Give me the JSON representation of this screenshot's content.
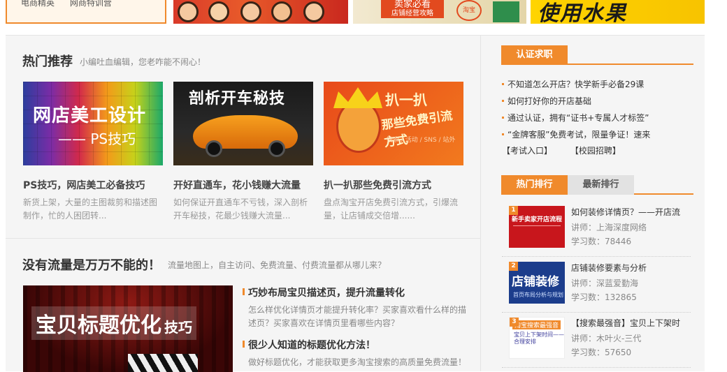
{
  "top": {
    "card1_items": [
      "电商精英",
      "网商特训营"
    ],
    "banner3_tag": "卖家必看",
    "banner3_sub": "店铺经营攻略",
    "banner3_seal": "淘宝",
    "banner4_text": "使用水果"
  },
  "hot": {
    "title": "热门推荐",
    "subtitle": "小编吐血编辑，您老咋能不闹心！",
    "cards": [
      {
        "thumb_line1": "网店美工设计",
        "thumb_line2": "—— PS技巧",
        "title": "PS技巧，网店美工必备技巧",
        "desc": "新货上架，大量的主图裁剪和描述图制作，忙的人困团转..."
      },
      {
        "thumb_line1": "剖析开车秘技",
        "title": "开好直通车，花小钱赚大流量",
        "desc": "如何保证开直通车不亏钱，深入剖析开车秘技，花最少钱赚大流量..."
      },
      {
        "thumb_line1": "扒一扒",
        "thumb_line2": "那些免费引流方式",
        "thumb_line3": "搜索 / 活动 / SNS / 站外",
        "title": "扒一扒那些免费引流方式",
        "desc": "盘点淘宝开店免费引流方式，引爆流量，让店铺成交倍增......"
      }
    ]
  },
  "traffic": {
    "title": "没有流量是万万不能的！",
    "subtitle": "流量地图上，自主访问、免费流量、付费流量都从哪儿来？",
    "thumb_text": "宝贝标题优化",
    "thumb_small": "技巧",
    "articles": [
      {
        "title": "巧妙布局宝贝描述页，提升流量转化",
        "desc": "怎么样优化详情页才能提升转化率？买家喜欢看什么样的描述页？买家喜欢在详情页里看哪些内容？"
      },
      {
        "title": "很少人知道的标题优化方法！",
        "desc": "做好标题优化，才能获取更多淘宝搜索的高质量免费流量！"
      }
    ]
  },
  "cert": {
    "tab": "认证求职",
    "items": [
      "不知道怎么开店？快学新手必备29课",
      "如何打好你的开店基础",
      "通过认证，拥有“证书+专属人才标签”",
      "“金牌客服”免费考试，限量争证！速来"
    ],
    "links": [
      "【考试入口】",
      "【校园招聘】"
    ]
  },
  "rank": {
    "tab_hot": "热门排行",
    "tab_new": "最新排行",
    "lecturer_label": "讲师：",
    "count_label": "学习数：",
    "items": [
      {
        "badge": "1",
        "pic_text": "新手卖家开店流程",
        "title": "如何装修详情页？——开店流",
        "lecturer": "上海深度网络",
        "count": "78446"
      },
      {
        "badge": "2",
        "pic_text": "店铺装修",
        "pic_sub": "首页布局分析与规划",
        "title": "店铺装修要素与分析",
        "lecturer": "深蓝爱勤海",
        "count": "132865"
      },
      {
        "badge": "3",
        "pic_text": "淘宝搜索最强音",
        "pic_sub": "宝贝上下架时间——合理安排",
        "title": "【搜索最强音】宝贝上下架时",
        "lecturer": "木叶火-三代",
        "count": "57650"
      }
    ]
  },
  "colors": {
    "accent": "#f08a2c",
    "panel": "#f5f5f5"
  }
}
